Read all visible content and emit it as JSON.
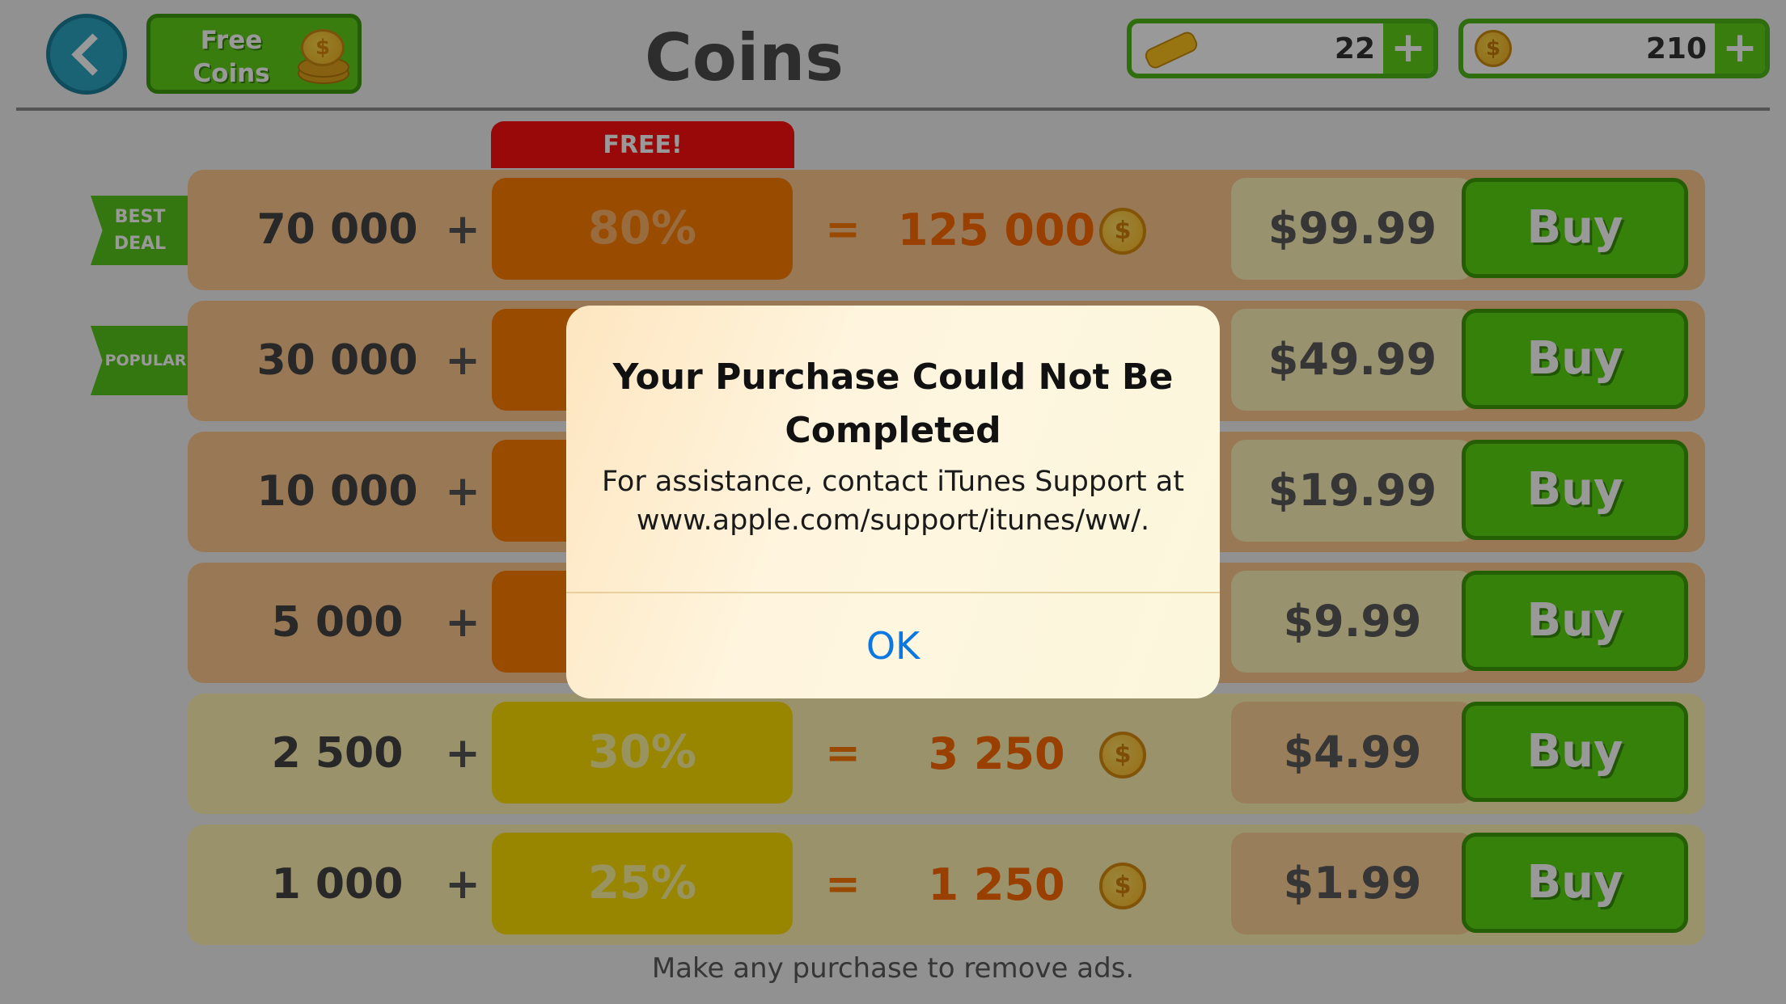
{
  "header": {
    "title": "Coins",
    "free_coins_label": "Free\nCoins",
    "tickets": "22",
    "coins": "210",
    "plus": "+"
  },
  "offer_tab": "FREE!",
  "ribbons": {
    "best": "BEST\nDEAL",
    "popular": "POPULAR"
  },
  "rows": [
    {
      "base": "70 000",
      "plus": "+",
      "bonus": "80%",
      "eq": "=",
      "total": "125 000",
      "price": "$99.99",
      "buy": "Buy"
    },
    {
      "base": "30 000",
      "plus": "+",
      "bonus": "",
      "eq": "",
      "total": "",
      "price": "$49.99",
      "buy": "Buy"
    },
    {
      "base": "10 000",
      "plus": "+",
      "bonus": "",
      "eq": "",
      "total": "",
      "price": "$19.99",
      "buy": "Buy"
    },
    {
      "base": "5 000",
      "plus": "+",
      "bonus": "",
      "eq": "",
      "total": "",
      "price": "$9.99",
      "buy": "Buy"
    },
    {
      "base": "2 500",
      "plus": "+",
      "bonus": "30%",
      "eq": "=",
      "total": "3 250",
      "price": "$4.99",
      "buy": "Buy"
    },
    {
      "base": "1 000",
      "plus": "+",
      "bonus": "25%",
      "eq": "=",
      "total": "1 250",
      "price": "$1.99",
      "buy": "Buy"
    }
  ],
  "footer": "Make any purchase to remove ads.",
  "alert": {
    "title": "Your Purchase Could Not Be Completed",
    "message": "For assistance, contact iTunes Support at www.apple.com/support/itunes/ww/.",
    "ok": "OK"
  },
  "icons": {
    "back": "back-arrow-icon",
    "coin": "coin-icon",
    "ticket": "bone-ticket-icon"
  },
  "colors": {
    "accent_green": "#59d812",
    "alert_button": "#0a78e0",
    "free_tab": "#ff1010"
  }
}
